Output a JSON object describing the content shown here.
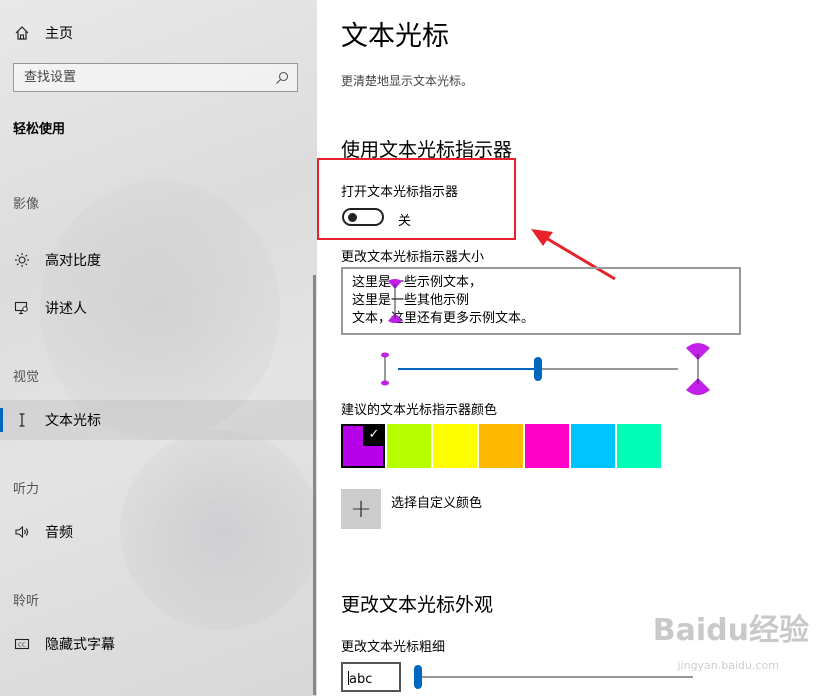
{
  "sidebar": {
    "home_label": "主页",
    "search_placeholder": "查找设置",
    "category_title": "轻松使用",
    "sections": {
      "vision": "影像",
      "vision2": "视觉",
      "hearing": "听力",
      "interaction": "聆听"
    },
    "items": {
      "high_contrast": "高对比度",
      "narrator": "讲述人",
      "text_cursor": "文本光标",
      "audio": "音频",
      "captions": "隐藏式字幕"
    }
  },
  "main": {
    "title": "文本光标",
    "description": "更清楚地显示文本光标。",
    "indicator_section_title": "使用文本光标指示器",
    "indicator_toggle_label": "打开文本光标指示器",
    "indicator_toggle_state": "关",
    "indicator_toggle_on": false,
    "size_label": "更改文本光标指示器大小",
    "preview_lines": [
      "这里是一些示例文本，",
      "这里是一些其他示例",
      "文本，这里还有更多示例文本。"
    ],
    "size_slider_value_fraction": 0.5,
    "colors_label": "建议的文本光标指示器颜色",
    "colors": [
      "#b600e8",
      "#b6ff00",
      "#ffff00",
      "#ffb900",
      "#ff00c7",
      "#00c4ff",
      "#00ffb6"
    ],
    "selected_color_index": 0,
    "custom_color_label": "选择自定义颜色",
    "appearance_section_title": "更改文本光标外观",
    "thickness_label": "更改文本光标粗细",
    "thickness_preview_value": "abc",
    "thickness_slider_value_fraction": 0.0,
    "accent_color": "#0067c0"
  },
  "watermark": {
    "brand": "Baidu经验",
    "url": "jingyan.baidu.com"
  }
}
